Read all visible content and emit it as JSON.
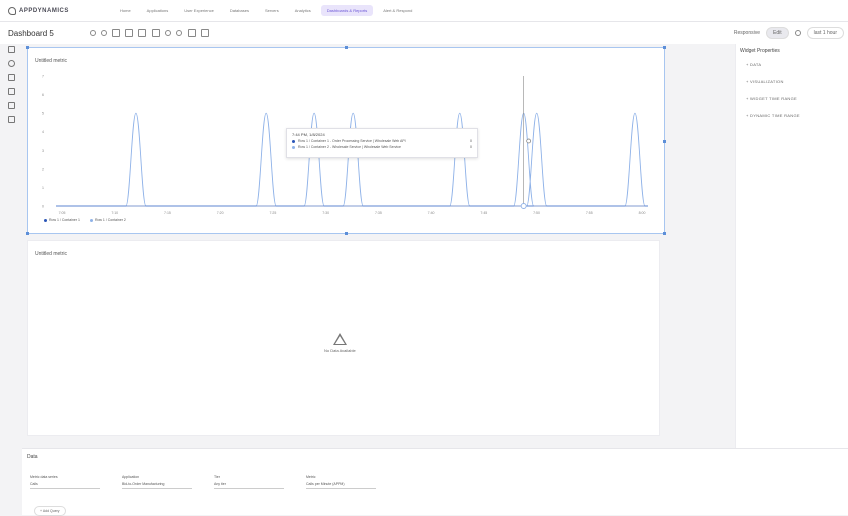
{
  "app": {
    "brand": "APPDYNAMICS"
  },
  "nav": {
    "tabs": [
      "Home",
      "Applications",
      "User Experience",
      "Databases",
      "Servers",
      "Analytics",
      "Dashboards & Reports",
      "Alert & Respond"
    ],
    "active_index": 6
  },
  "toolbar": {
    "dashboard_title": "Dashboard 5",
    "time_label": "last 1 hour",
    "mode_label": "Edit",
    "view_label": "Responsive"
  },
  "sidebar_icons": [
    "widget-icon",
    "refresh-icon",
    "list-icon",
    "grid-icon",
    "table-icon",
    "image-icon"
  ],
  "widget1": {
    "title": "Untitled metric",
    "tooltip": {
      "header": "7:44 PM, 1/8/2024",
      "rows": [
        {
          "label": "Row 1 / Container 1 - Order Processing Service | Wholesale Web API",
          "value": "0"
        },
        {
          "label": "Row 1 / Container 2 - Wholesale Service | Wholesale Web Service",
          "value": "0"
        }
      ]
    },
    "legend": [
      "Row 1 / Container 1",
      "Row 1 / Container 2"
    ]
  },
  "widget2": {
    "title": "Untitled metric",
    "empty_text": "No Data Available"
  },
  "right_panel": {
    "title": "Widget Properties",
    "items": [
      "+ DATA",
      "+ VISUALIZATION",
      "+ WIDGET TIME RANGE",
      "+ DYNAMIC TIME RANGE"
    ]
  },
  "bottom": {
    "title": "Data",
    "filters": [
      {
        "label": "Metric data series",
        "value": "Calls"
      },
      {
        "label": "Application",
        "value": "Bid-to-Order Manufacturing"
      },
      {
        "label": "Tier",
        "value": "Any tier"
      },
      {
        "label": "Metric",
        "value": "Calls per Minute (APPM)"
      }
    ],
    "add_label": "+ Add Query"
  },
  "chart_data": {
    "type": "line",
    "title": "Untitled metric",
    "xlabel": "",
    "ylabel": "",
    "x": [
      "7:05",
      "7:10",
      "7:15",
      "7:20",
      "7:25",
      "7:30",
      "7:35",
      "7:40",
      "7:45",
      "7:50",
      "7:55",
      "8:00"
    ],
    "ylim": [
      0,
      7
    ],
    "yticks": [
      0,
      1,
      2,
      3,
      4,
      5,
      6,
      7
    ],
    "spikes_x_fraction": [
      0.135,
      0.355,
      0.436,
      0.502,
      0.682,
      0.79,
      0.812,
      0.978
    ],
    "spike_height": 5,
    "series": [
      {
        "name": "Row 1 / Container 1",
        "color": "#2a56b8"
      },
      {
        "name": "Row 1 / Container 2",
        "color": "#8fb2e8"
      }
    ],
    "grid": false,
    "legend_position": "bottom-left"
  }
}
